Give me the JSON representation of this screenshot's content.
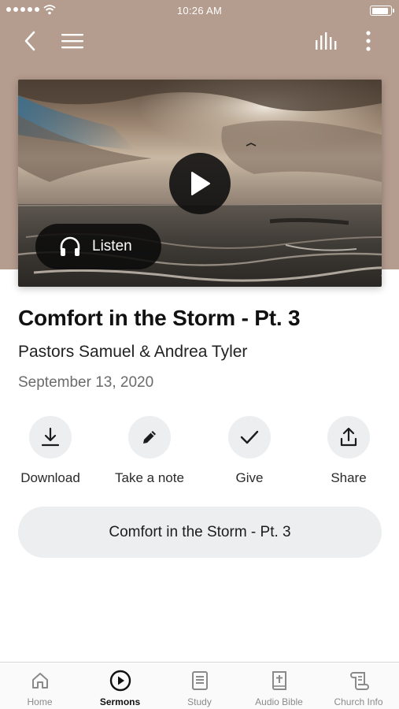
{
  "status_bar": {
    "time": "10:26 AM"
  },
  "header": {
    "back_icon": "chevron-left-icon",
    "menu_icon": "hamburger-menu-icon",
    "audio_icon": "audio-bars-icon",
    "more_icon": "more-vertical-icon",
    "background_color": "#b49c8e"
  },
  "media": {
    "listen_label": "Listen",
    "play_icon": "play-icon",
    "listen_icon": "headphones-icon"
  },
  "sermon": {
    "title": "Comfort in the Storm - Pt. 3",
    "speaker": "Pastors Samuel & Andrea Tyler",
    "date": "September 13, 2020"
  },
  "actions": [
    {
      "label": "Download",
      "icon": "download-icon"
    },
    {
      "label": "Take a note",
      "icon": "pencil-icon"
    },
    {
      "label": "Give",
      "icon": "checkmark-icon"
    },
    {
      "label": "Share",
      "icon": "share-icon"
    }
  ],
  "series_button": {
    "label": "Comfort in the Storm - Pt. 3"
  },
  "tabs": [
    {
      "label": "Home",
      "icon": "home-icon",
      "active": false
    },
    {
      "label": "Sermons",
      "icon": "play-circle-icon",
      "active": true
    },
    {
      "label": "Study",
      "icon": "study-icon",
      "active": false
    },
    {
      "label": "Audio Bible",
      "icon": "bible-icon",
      "active": false
    },
    {
      "label": "Church Info",
      "icon": "scroll-icon",
      "active": false
    }
  ]
}
